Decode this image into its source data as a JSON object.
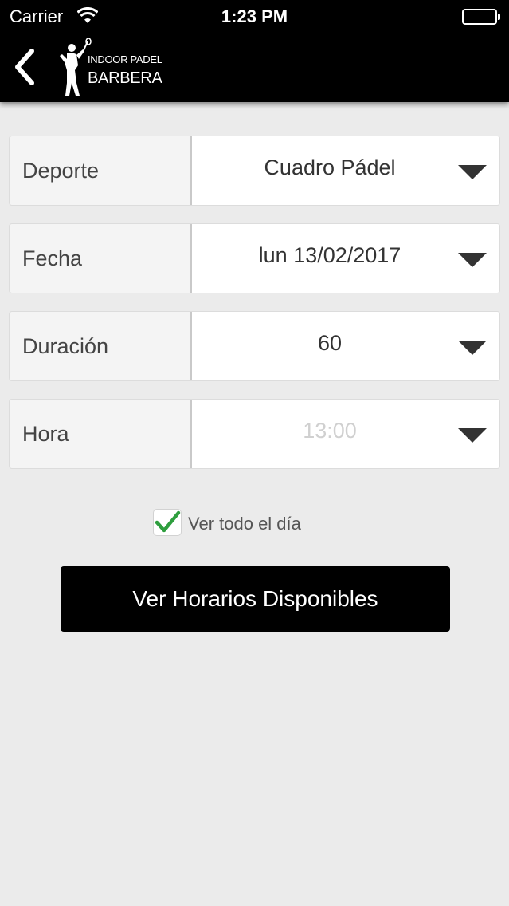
{
  "status_bar": {
    "carrier": "Carrier",
    "time": "1:23 PM",
    "battery_level": 1.0
  },
  "header": {
    "back_icon": "chevron-left-icon",
    "logo_icon": "padel-player-icon",
    "logo_line1": "INDOOR PADEL",
    "logo_line2": "BARBERA"
  },
  "form": {
    "rows": [
      {
        "label": "Deporte",
        "value": "Cuadro Pádel",
        "is_placeholder": false
      },
      {
        "label": "Fecha",
        "value": "lun 13/02/2017",
        "is_placeholder": false
      },
      {
        "label": "Duración",
        "value": "60",
        "is_placeholder": false
      },
      {
        "label": "Hora",
        "value": "13:00",
        "is_placeholder": true
      }
    ],
    "show_all_day": {
      "label": "Ver todo el día",
      "checked": true,
      "check_color": "#2e9e3e"
    },
    "submit_label": "Ver Horarios Disponibles"
  },
  "colors": {
    "background": "#ebebeb",
    "header": "#000000",
    "button": "#000000",
    "placeholder_text": "#d0d0d0"
  }
}
